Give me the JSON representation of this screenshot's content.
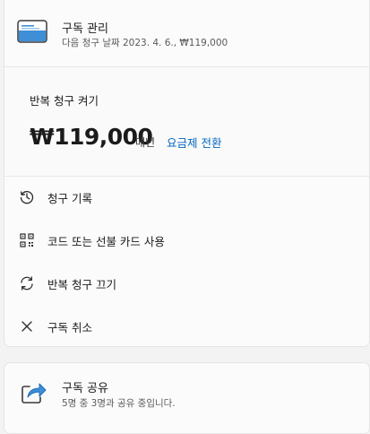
{
  "header": {
    "title": "구독 관리",
    "subtitle": "다음 청구 날짜 2023. 4. 6., ₩119,000",
    "icon": "credit-card-icon"
  },
  "renewal": {
    "label": "반복 청구 켜기",
    "price": "₩119,000",
    "period": "매년",
    "change_plan": "요금제 전환"
  },
  "menu": [
    {
      "label": "청구 기록",
      "icon": "history-icon"
    },
    {
      "label": "코드 또는 선불 카드 사용",
      "icon": "qr-code-icon"
    },
    {
      "label": "반복 청구 끄기",
      "icon": "sync-icon"
    },
    {
      "label": "구독 취소",
      "icon": "close-icon"
    }
  ],
  "share": {
    "title": "구독 공유",
    "subtitle": "5명 중 3명과 공유 중입니다.",
    "icon": "share-icon"
  },
  "colors": {
    "accent": "#0067c0",
    "card_icon_blue": "#3e8fd6",
    "background": "#f3f3f3",
    "card": "#fbfbfb"
  }
}
